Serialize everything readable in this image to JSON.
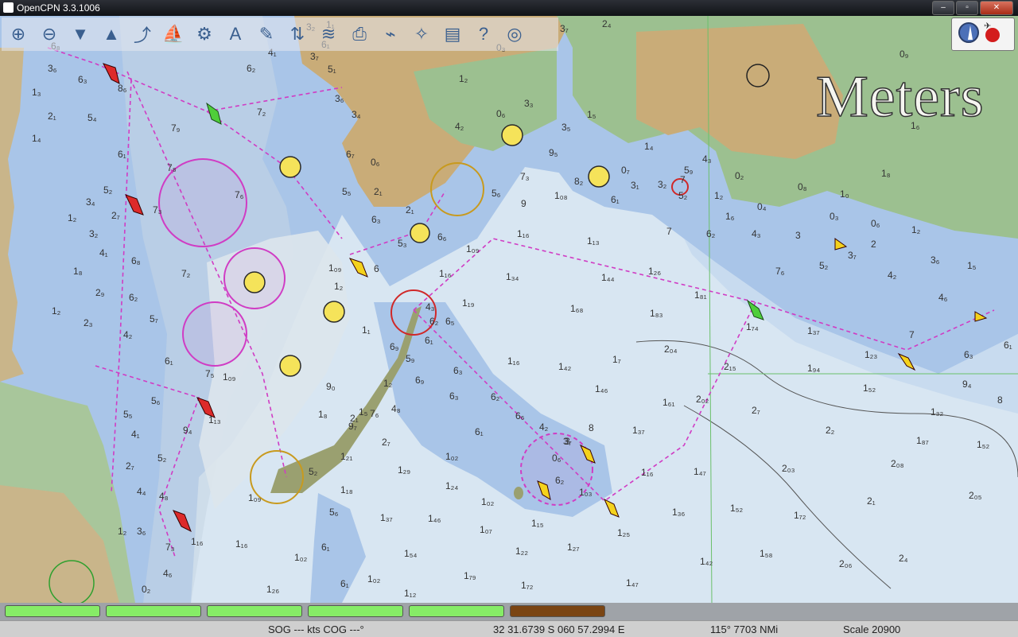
{
  "window": {
    "title": "OpenCPN 3.3.1006",
    "minimize": "–",
    "maximize": "▫",
    "close": "✕"
  },
  "toolbar": {
    "tools": [
      {
        "name": "zoom-in-icon",
        "glyph": "⊕"
      },
      {
        "name": "zoom-out-icon",
        "glyph": "⊖"
      },
      {
        "name": "scale-down-icon",
        "glyph": "▼"
      },
      {
        "name": "scale-up-icon",
        "glyph": "▲"
      },
      {
        "name": "route-icon",
        "glyph": "⤴"
      },
      {
        "name": "auto-follow-icon",
        "glyph": "⛵"
      },
      {
        "name": "settings-icon",
        "glyph": "⚙"
      },
      {
        "name": "text-icon",
        "glyph": "A"
      },
      {
        "name": "route-manager-icon",
        "glyph": "✎"
      },
      {
        "name": "current-icon",
        "glyph": "⇅"
      },
      {
        "name": "tide-icon",
        "glyph": "≋"
      },
      {
        "name": "print-icon",
        "glyph": "⎙"
      },
      {
        "name": "track-icon",
        "glyph": "⌁"
      },
      {
        "name": "mob-icon",
        "glyph": "✧"
      },
      {
        "name": "color-scheme-icon",
        "glyph": "▤"
      },
      {
        "name": "help-icon",
        "glyph": "?"
      },
      {
        "name": "lifebuoy-icon",
        "glyph": "◎"
      }
    ]
  },
  "units_label": "Meters",
  "piano": {
    "keys": [
      {
        "color": "#86ec67"
      },
      {
        "color": "#86ec67"
      },
      {
        "color": "#86ec67"
      },
      {
        "color": "#86ec67"
      },
      {
        "color": "#86ec67"
      },
      {
        "color": "#7a4514"
      }
    ]
  },
  "status": {
    "sog_cog": "SOG --- kts COG ---°",
    "position": "32 31.6739 S   060 57.2994 E",
    "bearing_distance": "115°  7703 NMi",
    "scale": "Scale 20900"
  },
  "chart": {
    "soundings": [
      [
        "6₈",
        64,
        62
      ],
      [
        "3₆",
        60,
        90
      ],
      [
        "6₃",
        98,
        104
      ],
      [
        "1₃",
        40,
        120
      ],
      [
        "2₁",
        60,
        150
      ],
      [
        "5₄",
        110,
        152
      ],
      [
        "8₆",
        148,
        115
      ],
      [
        "1₄",
        40,
        178
      ],
      [
        "6₁",
        148,
        198
      ],
      [
        "7₉",
        215,
        165
      ],
      [
        "7₈",
        210,
        215
      ],
      [
        "5₂",
        130,
        243
      ],
      [
        "3₄",
        108,
        258
      ],
      [
        "7₃",
        192,
        268
      ],
      [
        "2₇",
        140,
        275
      ],
      [
        "1₂",
        85,
        278
      ],
      [
        "3₂",
        112,
        298
      ],
      [
        "4₁",
        125,
        322
      ],
      [
        "6₈",
        165,
        332
      ],
      [
        "7₂",
        228,
        348
      ],
      [
        "1₈",
        92,
        345
      ],
      [
        "2₉",
        120,
        372
      ],
      [
        "6₂",
        162,
        378
      ],
      [
        "5₇",
        188,
        405
      ],
      [
        "2₃",
        105,
        410
      ],
      [
        "1₂",
        65,
        395
      ],
      [
        "4₂",
        155,
        425
      ],
      [
        "6₁",
        207,
        458
      ],
      [
        "7₅",
        258,
        474
      ],
      [
        "5₆",
        190,
        508
      ],
      [
        "5₅",
        155,
        525
      ],
      [
        "4₁",
        165,
        550
      ],
      [
        "5₂",
        198,
        580
      ],
      [
        "2₇",
        158,
        590
      ],
      [
        "4₄",
        172,
        622
      ],
      [
        "4₈",
        200,
        628
      ],
      [
        "3₆",
        172,
        672
      ],
      [
        "1₂",
        148,
        672
      ],
      [
        "7₃",
        208,
        692
      ],
      [
        "4₆",
        205,
        725
      ],
      [
        "0₂",
        178,
        745
      ],
      [
        "1₁₃",
        262,
        532
      ],
      [
        "9₄",
        230,
        545
      ],
      [
        "1₀₉",
        280,
        478
      ],
      [
        "1₁₆",
        240,
        685
      ],
      [
        "1₁₆",
        296,
        688
      ],
      [
        "1₀₉",
        312,
        630
      ],
      [
        "1₀₂",
        370,
        705
      ],
      [
        "1₂₆",
        335,
        745
      ],
      [
        "5₆",
        414,
        648
      ],
      [
        "6₁",
        404,
        692
      ],
      [
        "6₁",
        428,
        738
      ],
      [
        "1₀₂",
        462,
        732
      ],
      [
        "1₁₂",
        508,
        750
      ],
      [
        "1₁₈",
        428,
        620
      ],
      [
        "1₃₇",
        478,
        655
      ],
      [
        "1₂₉",
        500,
        595
      ],
      [
        "1₂₄",
        560,
        615
      ],
      [
        "1₀₂",
        560,
        578
      ],
      [
        "1₀₂",
        605,
        635
      ],
      [
        "1₀₇",
        603,
        670
      ],
      [
        "1₁₅",
        668,
        662
      ],
      [
        "1₂₂",
        648,
        697
      ],
      [
        "1₂₇",
        713,
        692
      ],
      [
        "1₇₉",
        583,
        728
      ],
      [
        "1₇₂",
        655,
        740
      ],
      [
        "1₄₇",
        787,
        737
      ],
      [
        "1₄₆",
        538,
        656
      ],
      [
        "1₅₄",
        508,
        700
      ],
      [
        "1₂₁",
        428,
        578
      ],
      [
        "9₇",
        438,
        540
      ],
      [
        "7₆",
        465,
        524
      ],
      [
        "6₉",
        522,
        482
      ],
      [
        "6₃",
        570,
        470
      ],
      [
        "6₃",
        565,
        502
      ],
      [
        "6₂",
        617,
        503
      ],
      [
        "6₁",
        597,
        547
      ],
      [
        "6₆",
        648,
        527
      ],
      [
        "4₂",
        678,
        541
      ],
      [
        "0₆",
        694,
        580
      ],
      [
        "6₂",
        698,
        608
      ],
      [
        "1₀₃",
        728,
        623
      ],
      [
        "1₂₅",
        776,
        674
      ],
      [
        "1₃₆",
        845,
        648
      ],
      [
        "1₃₇",
        795,
        545
      ],
      [
        "1₁₆",
        806,
        598
      ],
      [
        "1₄₇",
        872,
        597
      ],
      [
        "1₄₂",
        880,
        710
      ],
      [
        "1₅₂",
        918,
        643
      ],
      [
        "1₅₈",
        955,
        700
      ],
      [
        "1₇₂",
        998,
        652
      ],
      [
        "2₀₆",
        1055,
        713
      ],
      [
        "2₄",
        1130,
        706
      ],
      [
        "2₁",
        1090,
        634
      ],
      [
        "2₀₅",
        1218,
        627
      ],
      [
        "2₀₃",
        983,
        593
      ],
      [
        "2₀₈",
        1120,
        587
      ],
      [
        "1₈₇",
        1152,
        558
      ],
      [
        "1₅₂",
        1228,
        563
      ],
      [
        "2₂",
        1038,
        545
      ],
      [
        "2₇",
        945,
        520
      ],
      [
        "1₃₂",
        1170,
        522
      ],
      [
        "1₅₂",
        1085,
        492
      ],
      [
        "2₀₂",
        875,
        506
      ],
      [
        "1₆₁",
        833,
        510
      ],
      [
        "1₄₆",
        748,
        493
      ],
      [
        "1₇",
        770,
        456
      ],
      [
        "1₄₂",
        702,
        465
      ],
      [
        "1₁₆",
        638,
        458
      ],
      [
        "1₁₉",
        581,
        385
      ],
      [
        "1₆₈",
        717,
        392
      ],
      [
        "1₈₃",
        817,
        398
      ],
      [
        "2₀₄",
        835,
        443
      ],
      [
        "2₁₅",
        910,
        465
      ],
      [
        "1₉₄",
        1015,
        467
      ],
      [
        "1₂₃",
        1087,
        450
      ],
      [
        "1₇₄",
        938,
        415
      ],
      [
        "1₃₇",
        1015,
        420
      ],
      [
        "1₈₁",
        873,
        375
      ],
      [
        "1₄₄",
        756,
        353
      ],
      [
        "1₃₄",
        636,
        352
      ],
      [
        "1₂₆",
        815,
        345
      ],
      [
        "1₁₆",
        552,
        348
      ],
      [
        "1₀₉",
        586,
        317
      ],
      [
        "1₁₆",
        650,
        298
      ],
      [
        "1₁₃",
        738,
        307
      ],
      [
        "1₀₈",
        697,
        250
      ],
      [
        "7",
        838,
        295
      ],
      [
        "7₆",
        975,
        345
      ],
      [
        "5₂",
        1030,
        338
      ],
      [
        "4₂",
        1116,
        350
      ],
      [
        "4₆",
        1180,
        378
      ],
      [
        "6₃",
        1212,
        450
      ],
      [
        "7",
        1143,
        425
      ],
      [
        "9₄",
        1210,
        487
      ],
      [
        "1₂",
        1146,
        293
      ],
      [
        "2",
        1095,
        311
      ],
      [
        "3₇",
        1066,
        325
      ],
      [
        "3₆",
        1170,
        331
      ],
      [
        "1₅",
        1216,
        338
      ],
      [
        "6₁",
        1262,
        438
      ],
      [
        "8",
        1254,
        507
      ],
      [
        "0₃",
        1043,
        276
      ],
      [
        "0₆",
        1095,
        285
      ],
      [
        "0₄",
        952,
        264
      ],
      [
        "4₃",
        945,
        298
      ],
      [
        "6₂",
        888,
        298
      ],
      [
        "1₆",
        912,
        276
      ],
      [
        "1₂",
        898,
        250
      ],
      [
        "3",
        1000,
        300
      ],
      [
        "1₀",
        1056,
        248
      ],
      [
        "0₈",
        1003,
        239
      ],
      [
        "1₆",
        1145,
        162
      ],
      [
        "1₈",
        1108,
        222
      ],
      [
        "0₉",
        1131,
        72
      ],
      [
        "0₂",
        924,
        225
      ],
      [
        "4₃",
        883,
        204
      ],
      [
        "6₁",
        768,
        255
      ],
      [
        "8₂",
        722,
        232
      ],
      [
        "5₂",
        853,
        250
      ],
      [
        "3₂",
        827,
        236
      ],
      [
        "3₁",
        793,
        237
      ],
      [
        "0₇",
        781,
        218
      ],
      [
        "5₉",
        860,
        218
      ],
      [
        "7",
        855,
        230
      ],
      [
        "5₆",
        618,
        247
      ],
      [
        "7₃",
        654,
        226
      ],
      [
        "9",
        655,
        260
      ],
      [
        "6₆",
        550,
        302
      ],
      [
        "5₃",
        500,
        310
      ],
      [
        "6₃",
        467,
        280
      ],
      [
        "5₅",
        430,
        245
      ],
      [
        "2₁",
        470,
        245
      ],
      [
        "0₆",
        466,
        208
      ],
      [
        "1₂",
        577,
        103
      ],
      [
        "4₂",
        572,
        163
      ],
      [
        "3₄",
        442,
        148
      ],
      [
        "3₆",
        421,
        128
      ],
      [
        "0₆",
        624,
        147
      ],
      [
        "3₃",
        659,
        134
      ],
      [
        "3₅",
        706,
        164
      ],
      [
        "1₅",
        738,
        148
      ],
      [
        "1₄",
        810,
        188
      ],
      [
        "7₂",
        323,
        145
      ],
      [
        "6₂",
        310,
        90
      ],
      [
        "6₇",
        435,
        198
      ],
      [
        "9₅",
        690,
        196
      ],
      [
        "0₃",
        624,
        64
      ],
      [
        "3₇",
        704,
        40
      ],
      [
        "2₄",
        757,
        34
      ],
      [
        "1₁",
        410,
        35
      ],
      [
        "6₁",
        404,
        60
      ],
      [
        "4₁",
        337,
        70
      ],
      [
        "3₂",
        385,
        38
      ],
      [
        "3₇",
        390,
        75
      ],
      [
        "5₁",
        412,
        91
      ],
      [
        "2₁",
        510,
        268
      ],
      [
        "6",
        470,
        342
      ],
      [
        "1₀₉",
        413,
        341
      ],
      [
        "1₂",
        420,
        364
      ],
      [
        "4₃",
        535,
        390
      ],
      [
        "6₂",
        540,
        408
      ],
      [
        "6₅",
        560,
        408
      ],
      [
        "6₁",
        534,
        432
      ],
      [
        "1₂",
        482,
        486
      ],
      [
        "5₉",
        510,
        455
      ],
      [
        "6₉",
        490,
        440
      ],
      [
        "4₈",
        492,
        518
      ],
      [
        "1₅",
        451,
        522
      ],
      [
        "1₈",
        400,
        525
      ],
      [
        "2₇",
        480,
        560
      ],
      [
        "9₀",
        410,
        490
      ],
      [
        "7₆",
        295,
        249
      ],
      [
        "2₁",
        440,
        530
      ],
      [
        "1₁",
        455,
        419
      ],
      [
        "3₇",
        708,
        559
      ],
      [
        "3",
        710,
        559
      ],
      [
        "8",
        740,
        542
      ],
      [
        "5₂",
        388,
        597
      ]
    ]
  }
}
